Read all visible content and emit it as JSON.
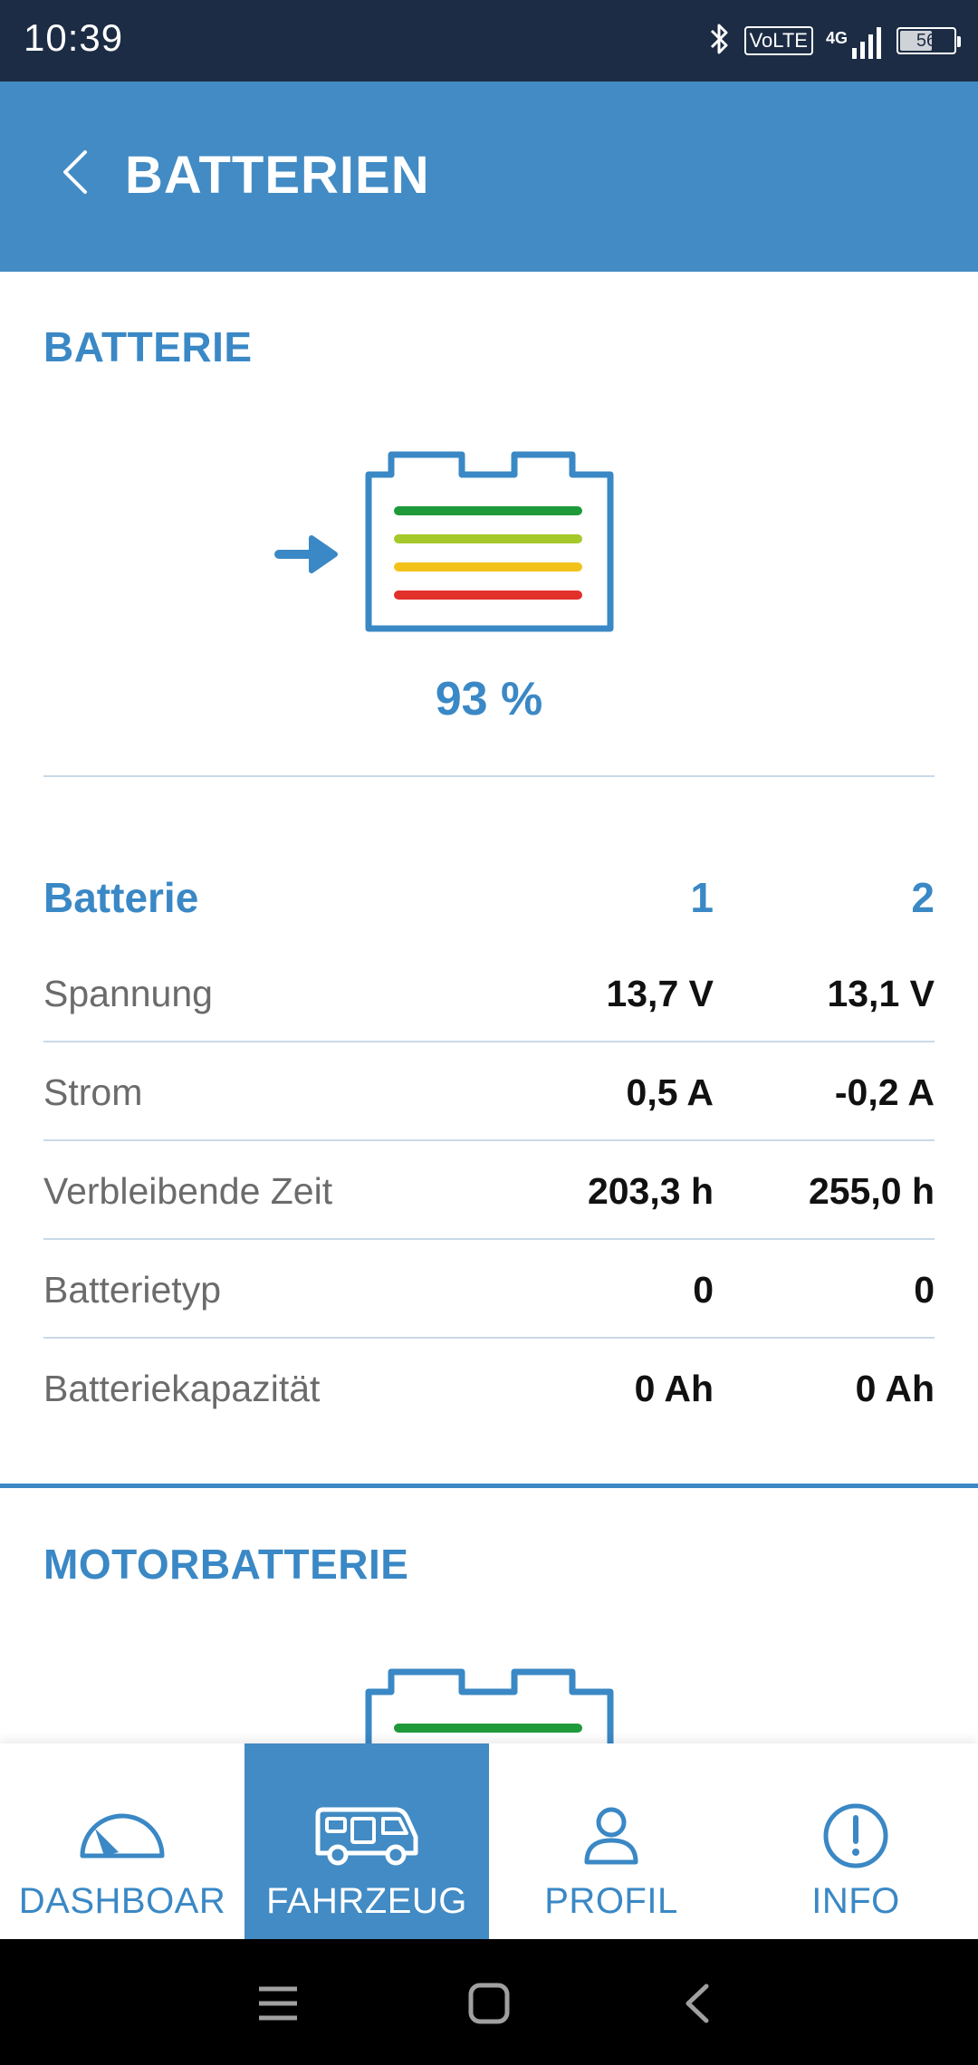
{
  "status_bar": {
    "time": "10:39",
    "volte": "VoLTE",
    "network": "4G",
    "battery_level": "56",
    "icons": [
      "bluetooth-icon",
      "volte-icon",
      "signal-icon",
      "battery-icon"
    ]
  },
  "app_bar": {
    "title": "BATTERIEN",
    "back_icon": "chevron-left-icon"
  },
  "battery_section": {
    "title": "BATTERIE",
    "charge_percent_label": "93 %",
    "charging_indicator": "arrow-right-icon",
    "level_bar_colors": [
      "#1f9a3a",
      "#a5c82a",
      "#f2c21b",
      "#e2302a"
    ],
    "table": {
      "header": {
        "label": "Batterie",
        "col1": "1",
        "col2": "2"
      },
      "rows": [
        {
          "label": "Spannung",
          "col1": "13,7 V",
          "col2": "13,1 V"
        },
        {
          "label": "Strom",
          "col1": "0,5 A",
          "col2": "-0,2 A"
        },
        {
          "label": "Verbleibende Zeit",
          "col1": "203,3 h",
          "col2": "255,0 h"
        },
        {
          "label": "Batterietyp",
          "col1": "0",
          "col2": "0"
        },
        {
          "label": "Batteriekapazität",
          "col1": "0 Ah",
          "col2": "0 Ah"
        }
      ]
    }
  },
  "motor_section": {
    "title": "MOTORBATTERIE"
  },
  "bottom_nav": {
    "items": [
      {
        "label": "DASHBOAR",
        "icon": "speedometer-icon",
        "active": false
      },
      {
        "label": "FAHRZEUG",
        "icon": "camper-van-icon",
        "active": true
      },
      {
        "label": "PROFIL",
        "icon": "user-icon",
        "active": false
      },
      {
        "label": "INFO",
        "icon": "info-icon",
        "active": false
      }
    ]
  },
  "colors": {
    "primary": "#428bc4",
    "accent_text": "#3a88c5",
    "status_bar": "#1c2c44"
  }
}
